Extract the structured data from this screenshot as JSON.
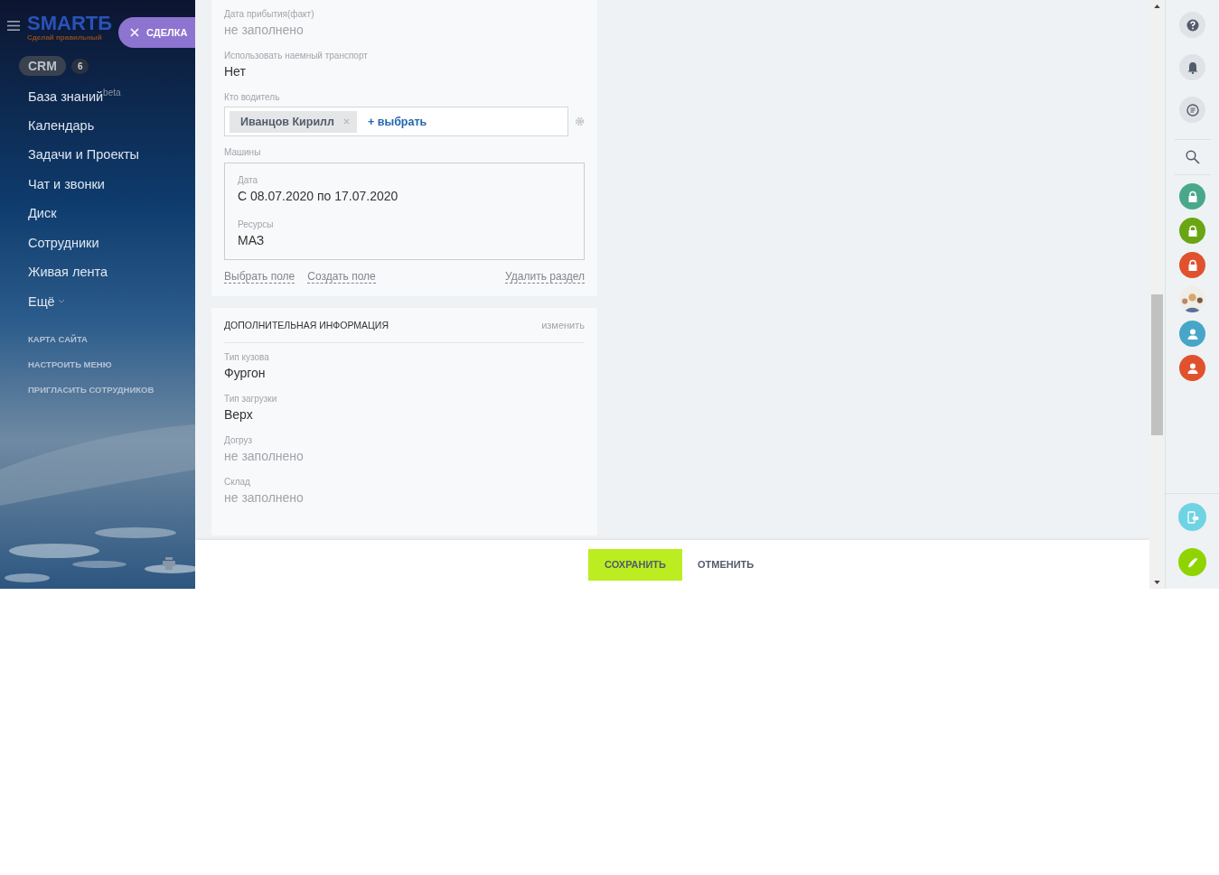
{
  "sidebar": {
    "logo": {
      "name": "SMARTБ",
      "tagline": "Сделай правильный"
    },
    "deal_tab": {
      "label": "СДЕЛКА"
    },
    "crm": {
      "label": "CRM",
      "count": "6"
    },
    "items": [
      {
        "label": "База знаний$^{beta}$"
      },
      {
        "label": "Календарь"
      },
      {
        "label": "Задачи и Проекты"
      },
      {
        "label": "Чат и звонки"
      },
      {
        "label": "Диск"
      },
      {
        "label": "Сотрудники"
      },
      {
        "label": "Живая лента"
      },
      {
        "label": "Ещё"
      }
    ],
    "links": [
      "КАРТА САЙТА",
      "НАСТРОИТЬ МЕНЮ",
      "ПРИГЛАСИТЬ СОТРУДНИКОВ"
    ]
  },
  "main_card": {
    "fields": [
      {
        "label": "Дата прибытия(факт)",
        "value": "не заполнено",
        "filled": false
      },
      {
        "label": "Использовать наемный транспорт",
        "value": "Нет",
        "filled": true
      }
    ],
    "driver": {
      "label": "Кто водитель",
      "chip": "Иванцов Кирилл",
      "add": "+ выбрать"
    },
    "machines": {
      "label": "Машины",
      "fields": [
        {
          "label": "Дата",
          "value": "С 08.07.2020 по 17.07.2020"
        },
        {
          "label": "Ресурсы",
          "value": "МАЗ"
        }
      ]
    },
    "links": [
      "Выбрать поле",
      "Создать поле"
    ],
    "delete_link": "Удалить раздел"
  },
  "extra_card": {
    "title": "ДОПОЛНИТЕЛЬНАЯ ИНФОРМАЦИЯ",
    "edit": "изменить",
    "fields": [
      {
        "label": "Тип кузова",
        "value": "Фургон",
        "filled": true
      },
      {
        "label": "Тип загрузки",
        "value": "Верх",
        "filled": true
      },
      {
        "label": "Догруз",
        "value": "не заполнено",
        "filled": false
      },
      {
        "label": "Склад",
        "value": "не заполнено",
        "filled": false
      }
    ]
  },
  "footer": {
    "save": "СОХРАНИТЬ",
    "cancel": "ОТМЕНИТЬ"
  }
}
